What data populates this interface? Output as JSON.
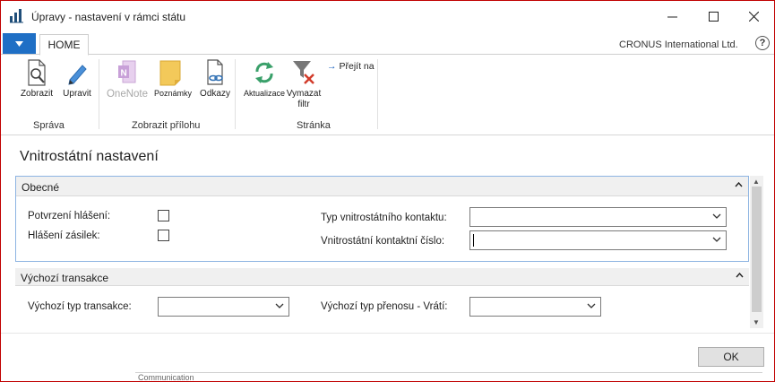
{
  "window": {
    "title": "Úpravy - nastavení v rámci státu",
    "company": "CRONUS International Ltd.",
    "help": "?"
  },
  "tabs": {
    "home": "HOME"
  },
  "ribbon": {
    "groups": {
      "sprava": {
        "label": "Správa",
        "buttons": {
          "zobrazit": "Zobrazit",
          "upravit": "Upravit"
        }
      },
      "priloha": {
        "label": "Zobrazit přílohu",
        "buttons": {
          "onenote": "OneNote",
          "poznamky": "Poznámky",
          "odkazy": "Odkazy"
        }
      },
      "stranka": {
        "label": "Stránka",
        "buttons": {
          "aktualizace": "Aktualizace",
          "vymazat_filtr_1": "Vymazat",
          "vymazat_filtr_2": "filtr",
          "prejit_na": "Přejít na"
        }
      }
    }
  },
  "page": {
    "title": "Vnitrostátní nastavení",
    "general": {
      "header": "Obecné",
      "fields": {
        "potvrzeni": "Potvrzení hlášení:",
        "hlaseni_zasilek": "Hlášení zásilek:",
        "typ_kontaktu": "Typ vnitrostátního kontaktu:",
        "kontaktni_cislo": "Vnitrostátní kontaktní číslo:"
      },
      "values": {
        "potvrzeni_checked": false,
        "hlaseni_zasilek_checked": false,
        "typ_kontaktu": "",
        "kontaktni_cislo": ""
      }
    },
    "transakce": {
      "header": "Výchozí transakce",
      "fields": {
        "typ_transakce": "Výchozí typ transakce:",
        "typ_prenosu_vrati": "Výchozí typ přenosu - Vrátí:"
      },
      "values": {
        "typ_transakce": "",
        "typ_prenosu_vrati": ""
      }
    }
  },
  "footer": {
    "ok": "OK"
  },
  "background": {
    "strip_text": "Communication"
  },
  "colors": {
    "accent": "#1f6fc5",
    "fasttab_border": "#8db4e2",
    "window_border": "#c00000"
  }
}
